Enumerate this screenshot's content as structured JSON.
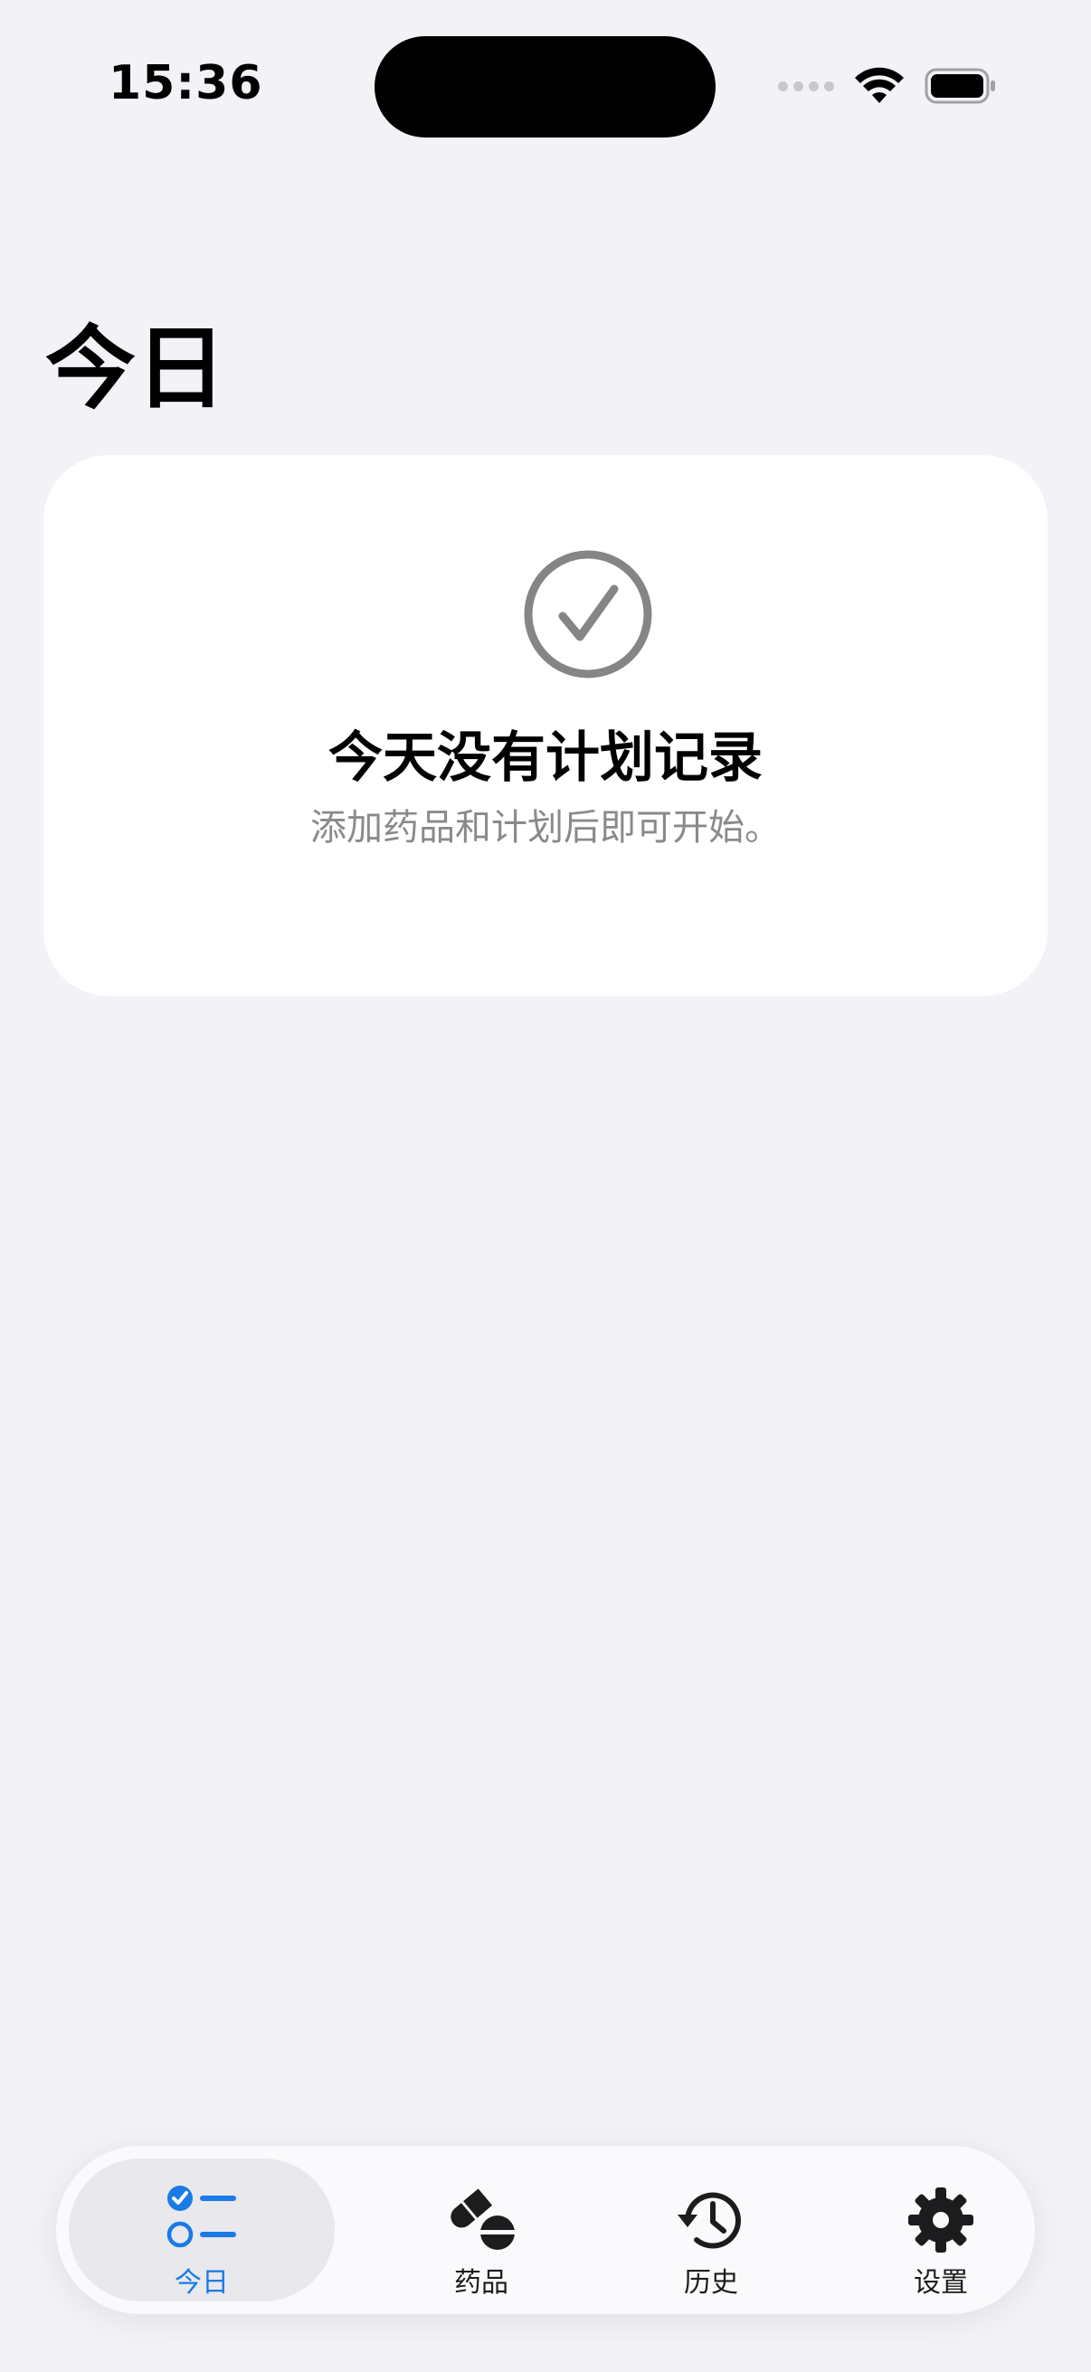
{
  "status_bar": {
    "time": "15:36"
  },
  "header": {
    "title": "今日"
  },
  "empty_state": {
    "icon": "checkmark-circle-icon",
    "title": "今天没有计划记录",
    "subtitle": "添加药品和计划后即可开始。"
  },
  "tab_bar": {
    "tabs": [
      {
        "label": "今日",
        "icon": "checklist-icon",
        "selected": true
      },
      {
        "label": "药品",
        "icon": "pills-icon",
        "selected": false
      },
      {
        "label": "历史",
        "icon": "history-clock-icon",
        "selected": false
      },
      {
        "label": "设置",
        "icon": "gear-icon",
        "selected": false
      }
    ]
  },
  "colors": {
    "background": "#F2F2F7",
    "card": "#FFFFFF",
    "accent": "#1A7AE6",
    "secondary_text": "#8A8A8E"
  }
}
